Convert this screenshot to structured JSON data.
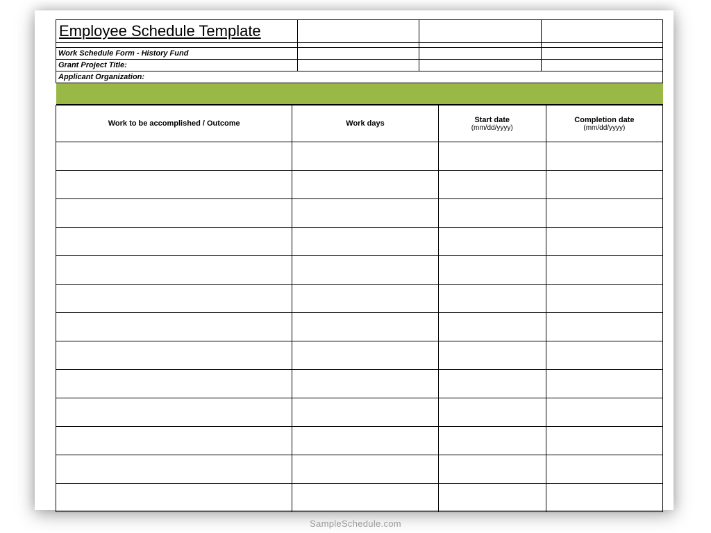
{
  "title": "Employee Schedule Template",
  "meta": {
    "form_name": "Work Schedule Form - History Fund",
    "grant_label": "Grant Project Title:",
    "org_label": "Applicant Organization:"
  },
  "columns": {
    "work": "Work to be accomplished / Outcome",
    "days": "Work days",
    "start": "Start date",
    "start_fmt": "(mm/dd/yyyy)",
    "end": "Completion date",
    "end_fmt": "(mm/dd/yyyy)"
  },
  "row_count": 13,
  "watermark": "SampleSchedule.com",
  "colors": {
    "band": "#99b846"
  }
}
